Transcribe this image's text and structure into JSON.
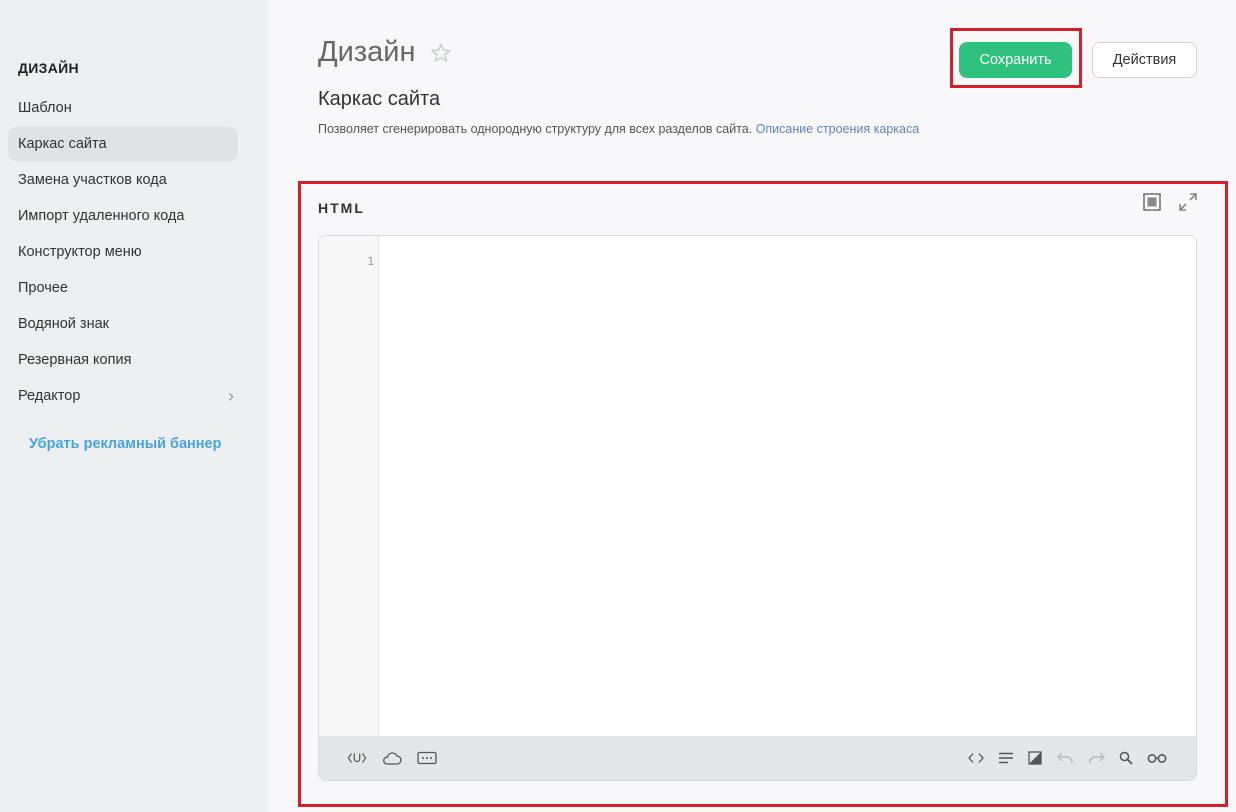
{
  "sidebar": {
    "heading": "ДИЗАЙН",
    "items": [
      {
        "label": "Шаблон"
      },
      {
        "label": "Каркас сайта",
        "active": true
      },
      {
        "label": "Замена участков кода"
      },
      {
        "label": "Импорт удаленного кода"
      },
      {
        "label": "Конструктор меню"
      },
      {
        "label": "Прочее"
      },
      {
        "label": "Водяной знак"
      },
      {
        "label": "Резервная копия"
      },
      {
        "label": "Редактор"
      }
    ],
    "promo_link": "Убрать рекламный баннер"
  },
  "header": {
    "title": "Дизайн",
    "subtitle": "Каркас сайта",
    "description": "Позволяет сгенерировать однородную структуру для всех разделов сайта.",
    "description_link": "Описание строения каркаса",
    "save_label": "Сохранить",
    "actions_label": "Действия"
  },
  "editor": {
    "label": "HTML",
    "line_numbers": [
      "1"
    ],
    "toolbar_left_icons": [
      "variable-insert-icon",
      "cloud-icon",
      "keyboard-icon"
    ],
    "toolbar_right_icons": [
      "code-icon",
      "align-icon",
      "theme-icon",
      "undo-icon",
      "redo-icon",
      "search-icon",
      "glasses-icon"
    ]
  },
  "colors": {
    "accent_green": "#2ec27e",
    "link_blue": "#4aa3df",
    "highlight_red": "#d21f2a"
  }
}
